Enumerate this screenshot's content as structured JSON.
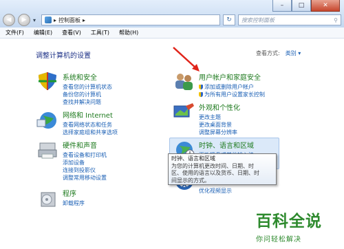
{
  "address": {
    "crumb": "控制面板",
    "sep": "▸",
    "search_placeholder": "搜索控制面板"
  },
  "menu": [
    "文件(F)",
    "编辑(E)",
    "查看(V)",
    "工具(T)",
    "帮助(H)"
  ],
  "heading": "调整计算机的设置",
  "viewby": {
    "label": "查看方式:",
    "value": "类别 ▾"
  },
  "categories": {
    "system": {
      "title": "系统和安全",
      "links": [
        "查看您的计算机状态",
        "备份您的计算机",
        "查找并解决问题"
      ]
    },
    "network": {
      "title": "网络和 Internet",
      "links": [
        "查看网络状态和任务",
        "选择家庭组和共享选项"
      ]
    },
    "hardware": {
      "title": "硬件和声音",
      "links": [
        "查看设备和打印机",
        "添加设备",
        "连接到投影仪",
        "调整常用移动设置"
      ]
    },
    "programs": {
      "title": "程序",
      "links": [
        "卸载程序"
      ]
    },
    "users": {
      "title": "用户帐户和家庭安全",
      "links": [
        "添加或删除用户帐户",
        "为所有用户设置家长控制"
      ]
    },
    "appearance": {
      "title": "外观和个性化",
      "links": [
        "更改主题",
        "更改桌面背景",
        "调整屏幕分辨率"
      ]
    },
    "clock": {
      "title": "时钟、语言和区域",
      "links": [
        "更改键盘或其他输入法"
      ]
    },
    "ease": {
      "links": [
        "优化视频显示"
      ]
    }
  },
  "tooltip": {
    "title": "时钟、语言和区域",
    "lines": [
      "为您的计算机更改时间、日期、时",
      "区、使用的语言以及货币、日期、时",
      "间显示的方式。"
    ]
  },
  "watermark": {
    "big": "百科全说",
    "small": "你问轻松解决"
  },
  "colors": {
    "link": "#1a5fb4",
    "category_title": "#1e7a1e",
    "heading": "#1e3287",
    "arrow": "#e0241a",
    "watermark": "#2e8a2e"
  }
}
